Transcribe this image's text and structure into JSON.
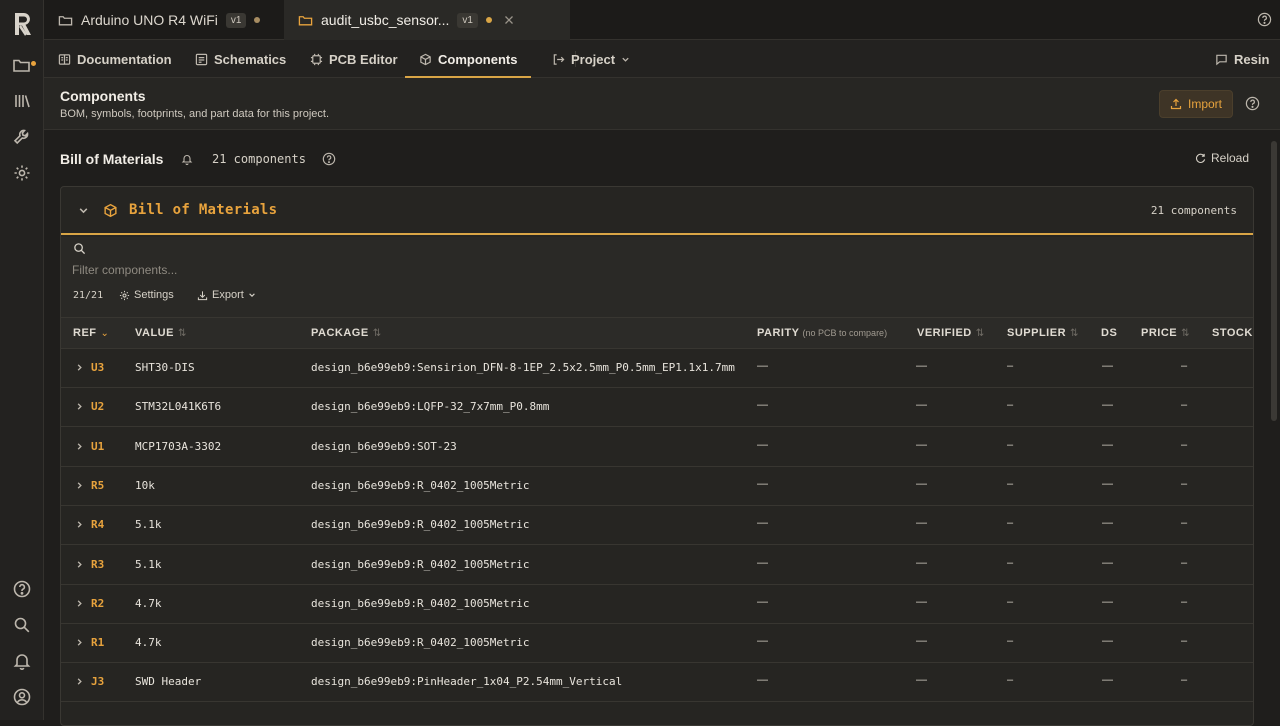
{
  "tabs": [
    {
      "label": "Arduino UNO R4 WiFi",
      "version": "v1"
    },
    {
      "label": "audit_usbc_sensor...",
      "version": "v1"
    }
  ],
  "nav": {
    "documentation": "Documentation",
    "schematics": "Schematics",
    "pcb_editor": "PCB Editor",
    "components": "Components",
    "project": "Project",
    "resin": "Resin"
  },
  "page": {
    "title": "Components",
    "subtitle": "BOM, symbols, footprints, and part data for this project.",
    "import_label": "Import"
  },
  "bom": {
    "title": "Bill of Materials",
    "count": "21 components",
    "reload": "Reload",
    "card_title": "Bill of Materials",
    "card_count": "21 components",
    "filter_placeholder": "Filter components...",
    "filter_count": "21/21",
    "settings": "Settings",
    "export": "Export"
  },
  "columns": {
    "ref": "REF",
    "value": "VALUE",
    "package": "PACKAGE",
    "parity": "PARITY",
    "parity_note": "(no PCB to compare)",
    "verified": "VERIFIED",
    "supplier": "SUPPLIER",
    "ds": "DS",
    "price": "PRICE",
    "stock": "STOCK"
  },
  "rows": [
    {
      "ref": "U3",
      "value": "SHT30-DIS",
      "package": "design_b6e99eb9:Sensirion_DFN-8-1EP_2.5x2.5mm_P0.5mm_EP1.1x1.7mm",
      "parity": "—",
      "verified": "—",
      "supplier": "–",
      "ds": "—",
      "price": "–"
    },
    {
      "ref": "U2",
      "value": "STM32L041K6T6",
      "package": "design_b6e99eb9:LQFP-32_7x7mm_P0.8mm",
      "parity": "—",
      "verified": "—",
      "supplier": "–",
      "ds": "—",
      "price": "–"
    },
    {
      "ref": "U1",
      "value": "MCP1703A-3302",
      "package": "design_b6e99eb9:SOT-23",
      "parity": "—",
      "verified": "—",
      "supplier": "–",
      "ds": "—",
      "price": "–"
    },
    {
      "ref": "R5",
      "value": "10k",
      "package": "design_b6e99eb9:R_0402_1005Metric",
      "parity": "—",
      "verified": "—",
      "supplier": "–",
      "ds": "—",
      "price": "–"
    },
    {
      "ref": "R4",
      "value": "5.1k",
      "package": "design_b6e99eb9:R_0402_1005Metric",
      "parity": "—",
      "verified": "—",
      "supplier": "–",
      "ds": "—",
      "price": "–"
    },
    {
      "ref": "R3",
      "value": "5.1k",
      "package": "design_b6e99eb9:R_0402_1005Metric",
      "parity": "—",
      "verified": "—",
      "supplier": "–",
      "ds": "—",
      "price": "–"
    },
    {
      "ref": "R2",
      "value": "4.7k",
      "package": "design_b6e99eb9:R_0402_1005Metric",
      "parity": "—",
      "verified": "—",
      "supplier": "–",
      "ds": "—",
      "price": "–"
    },
    {
      "ref": "R1",
      "value": "4.7k",
      "package": "design_b6e99eb9:R_0402_1005Metric",
      "parity": "—",
      "verified": "—",
      "supplier": "–",
      "ds": "—",
      "price": "–"
    },
    {
      "ref": "J3",
      "value": "SWD Header",
      "package": "design_b6e99eb9:PinHeader_1x04_P2.54mm_Vertical",
      "parity": "—",
      "verified": "—",
      "supplier": "–",
      "ds": "—",
      "price": "–"
    }
  ],
  "colors": {
    "accent": "#e8a33d",
    "bg": "#1f1e1c"
  }
}
